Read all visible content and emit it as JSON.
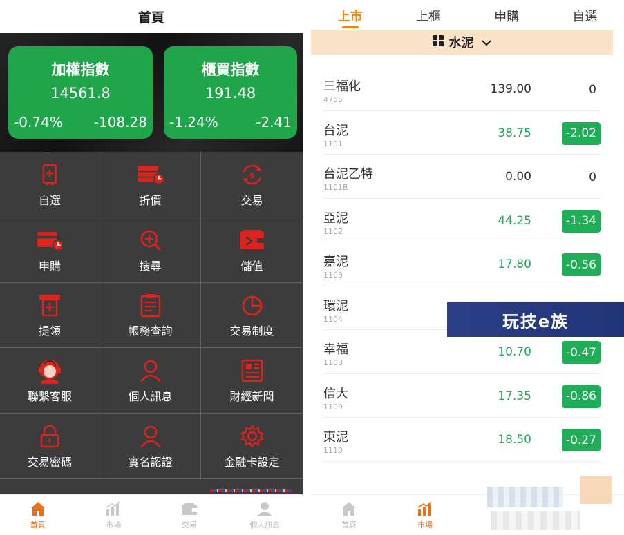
{
  "left": {
    "title": "首頁",
    "indices": [
      {
        "name": "加權指數",
        "value": "14561.8",
        "pct": "-0.74%",
        "change": "-108.28"
      },
      {
        "name": "櫃買指數",
        "value": "191.48",
        "pct": "-1.24%",
        "change": "-2.41"
      }
    ],
    "menu": [
      {
        "label": "自選",
        "icon": "bookmark-icon"
      },
      {
        "label": "折價",
        "icon": "card-clock-icon"
      },
      {
        "label": "交易",
        "icon": "exchange-icon"
      },
      {
        "label": "申購",
        "icon": "card-clock-icon"
      },
      {
        "label": "搜尋",
        "icon": "search-icon"
      },
      {
        "label": "儲值",
        "icon": "wallet-icon"
      },
      {
        "label": "提領",
        "icon": "atm-icon"
      },
      {
        "label": "帳務查詢",
        "icon": "clipboard-icon"
      },
      {
        "label": "交易制度",
        "icon": "pie-chart-icon"
      },
      {
        "label": "聯繫客服",
        "icon": "headset-icon"
      },
      {
        "label": "個人訊息",
        "icon": "user-icon"
      },
      {
        "label": "財經新聞",
        "icon": "newspaper-icon"
      },
      {
        "label": "交易密碼",
        "icon": "lock-icon"
      },
      {
        "label": "實名認證",
        "icon": "user-icon"
      },
      {
        "label": "金融卡設定",
        "icon": "gear-icon"
      }
    ],
    "tabbar": [
      {
        "label": "首頁",
        "icon": "home-icon",
        "active": true
      },
      {
        "label": "市場",
        "icon": "bar-chart-icon",
        "active": false
      },
      {
        "label": "交易",
        "icon": "wallet-icon",
        "active": false
      },
      {
        "label": "個人訊息",
        "icon": "user-icon",
        "active": false
      }
    ]
  },
  "right": {
    "market_tabs": [
      "上市",
      "上櫃",
      "申購",
      "自選"
    ],
    "active_tab": "上市",
    "category": "水泥",
    "stocks": [
      {
        "name": "三福化",
        "code": "4755",
        "price": "139.00",
        "change": "0",
        "trend": "flat"
      },
      {
        "name": "台泥",
        "code": "1101",
        "price": "38.75",
        "change": "-2.02",
        "trend": "down"
      },
      {
        "name": "台泥乙特",
        "code": "1101B",
        "price": "0.00",
        "change": "0",
        "trend": "flat"
      },
      {
        "name": "亞泥",
        "code": "1102",
        "price": "44.25",
        "change": "-1.34",
        "trend": "down"
      },
      {
        "name": "嘉泥",
        "code": "1103",
        "price": "17.80",
        "change": "-0.56",
        "trend": "down"
      },
      {
        "name": "環泥",
        "code": "1104",
        "price": "",
        "change": "",
        "trend": "hidden"
      },
      {
        "name": "幸福",
        "code": "1108",
        "price": "10.70",
        "change": "-0.47",
        "trend": "down"
      },
      {
        "name": "信大",
        "code": "1109",
        "price": "17.35",
        "change": "-0.86",
        "trend": "down"
      },
      {
        "name": "東泥",
        "code": "1110",
        "price": "18.50",
        "change": "-0.27",
        "trend": "down"
      }
    ],
    "tabbar": [
      {
        "label": "首頁",
        "icon": "home-icon",
        "active": false
      },
      {
        "label": "市場",
        "icon": "bar-chart-icon",
        "active": true
      }
    ]
  },
  "watermark": "玩技e族",
  "colors": {
    "accent_red": "#e0221d",
    "green": "#1fa64a",
    "orange": "#f2850d"
  }
}
